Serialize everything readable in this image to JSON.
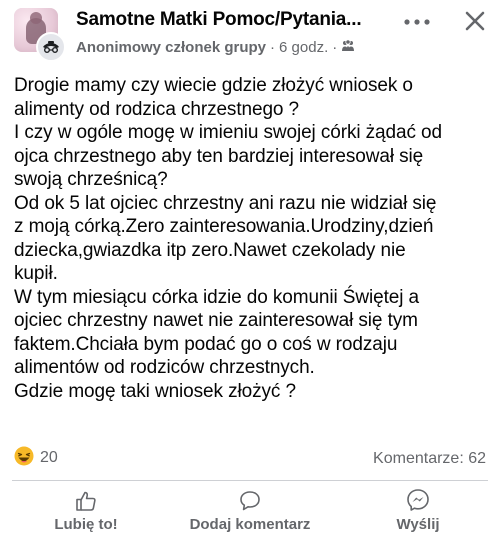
{
  "post": {
    "group_name": "Samotne Matki Pomoc/Pytania...",
    "author": "Anonimowy członek grupy",
    "separator": "·",
    "time": "6 godz.",
    "separator2": "·",
    "body": "Drogie mamy czy wiecie gdzie złożyć wniosek o\nalimenty od rodzica chrzestnego ?\nI czy w ogóle mogę w imieniu swojej córki żądać od\nojca chrzestnego  aby ten bardziej interesował się\nswoją chrześnicą?\nOd ok 5 lat ojciec chrzestny ani razu nie widział się\nz moją córką.Zero zainteresowania.Urodziny,dzień\ndziecka,gwiazdka itp zero.Nawet czekolady nie\nkupił.\nW tym miesiącu córka idzie do komunii Świętej a\nojciec chrzestny nawet nie zainteresował się tym\nfaktem.Chciała bym podać go o coś w rodzaju\nalimentów od rodziców chrzestnych.\nGdzie mogę taki wniosek złożyć ?"
  },
  "stats": {
    "reactions_count": "20",
    "comments_label": "Komentarze: 62"
  },
  "actions": {
    "like": "Lubię to!",
    "comment": "Dodaj komentarz",
    "send": "Wyślij"
  },
  "icons": {
    "avatar": "group-avatar",
    "anon": "anonymous-icon",
    "privacy": "group-privacy-icon",
    "more": "more-options-icon",
    "close": "close-icon",
    "reaction": "haha-emoji-icon",
    "like": "thumbs-up-icon",
    "comment": "speech-bubble-icon",
    "send": "messenger-icon"
  },
  "colors": {
    "text": "#050505",
    "secondary": "#65676b",
    "divider": "#ced0d4",
    "emoji": "#f7b928"
  }
}
